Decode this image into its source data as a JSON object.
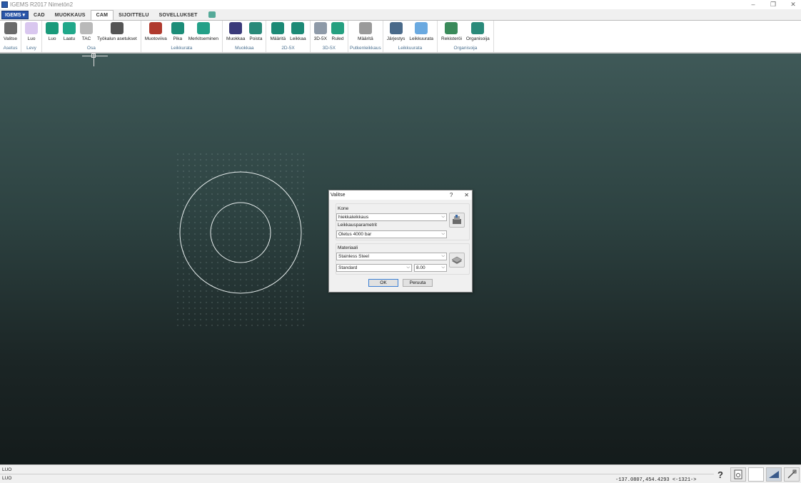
{
  "window": {
    "title": "IGEMS R2017 Nimetön2",
    "controls": [
      "–",
      "❐",
      "✕"
    ]
  },
  "app_menu": {
    "label": "IGEMS ▾"
  },
  "tabs": [
    {
      "label": "CAD",
      "active": false
    },
    {
      "label": "MUOKKAUS",
      "active": false
    },
    {
      "label": "CAM",
      "active": true
    },
    {
      "label": "SIJOITTELU",
      "active": false
    },
    {
      "label": "SOVELLUKSET",
      "active": false
    }
  ],
  "ribbon": {
    "groups": [
      {
        "label": "Asetus",
        "buttons": [
          {
            "label": "Valitse",
            "icon": "machine-icon",
            "color": "#6a6a6a"
          }
        ]
      },
      {
        "label": "Levy",
        "buttons": [
          {
            "label": "Luo",
            "icon": "sheet-icon",
            "color": "#d9c7ef"
          }
        ]
      },
      {
        "label": "Osa",
        "buttons": [
          {
            "label": "Luo",
            "icon": "part-create-icon",
            "color": "#1a9a7a"
          },
          {
            "label": "Laatu",
            "icon": "quality-icon",
            "color": "#21a88a"
          },
          {
            "label": "TAC",
            "icon": "tac-icon",
            "color": "#b9b9b9"
          },
          {
            "label": "Työkalun asetukset",
            "icon": "tool-settings-icon",
            "color": "#555555"
          }
        ]
      },
      {
        "label": "Leikkurata",
        "buttons": [
          {
            "label": "Muotoviiva",
            "icon": "contour-icon",
            "color": "#b03a2e"
          },
          {
            "label": "Pika",
            "icon": "quick-icon",
            "color": "#1c8d78"
          },
          {
            "label": "Merkitseminen",
            "icon": "marking-icon",
            "color": "#23a088"
          }
        ]
      },
      {
        "label": "Muokkaa",
        "buttons": [
          {
            "label": "Muokkaa",
            "icon": "edit-path-icon",
            "color": "#3a3a7a"
          },
          {
            "label": "Poista",
            "icon": "delete-path-icon",
            "color": "#2a8a7a"
          }
        ]
      },
      {
        "label": "2D-5X",
        "buttons": [
          {
            "label": "Määritä",
            "icon": "define-2d5x-icon",
            "color": "#1c8a76"
          },
          {
            "label": "Leikkaa",
            "icon": "cut-2d5x-icon",
            "color": "#1c8a76"
          }
        ]
      },
      {
        "label": "3D-5X",
        "buttons": [
          {
            "label": "3D-5X",
            "icon": "3d5x-icon",
            "color": "#8e9aa8"
          },
          {
            "label": "Ruled",
            "icon": "ruled-icon",
            "color": "#25a080"
          }
        ]
      },
      {
        "label": "Putkenleikkaus",
        "buttons": [
          {
            "label": "Määritä",
            "icon": "tube-icon",
            "color": "#9a9a9a"
          }
        ]
      },
      {
        "label": "Leikkuurata",
        "buttons": [
          {
            "label": "Järjestys",
            "icon": "sequence-icon",
            "color": "#4a6a8a"
          },
          {
            "label": "Leikkuurata",
            "icon": "play-path-icon",
            "color": "#6aa9e0"
          }
        ]
      },
      {
        "label": "Organisoija",
        "buttons": [
          {
            "label": "Rekisteröi",
            "icon": "register-icon",
            "color": "#3a8a5a"
          },
          {
            "label": "Organisoija",
            "icon": "organizer-icon",
            "color": "#2a8a7a"
          }
        ]
      }
    ]
  },
  "dialog": {
    "title": "Valitse",
    "help": "?",
    "close": "✕",
    "machine_label": "Kone",
    "machine_value": "hiekkaleikkaus",
    "params_label": "Leikkausparametrit",
    "params_value": "Oletus 4000 bar",
    "material_label": "Materiaali",
    "material_value": "Stainless Steel",
    "grade_value": "Standard",
    "thickness_value": "8.00",
    "ok_label": "OK",
    "cancel_label": "Peruuta"
  },
  "status": {
    "line1": "LUO",
    "line2": "LUO",
    "coords": "-137.0807,454.4293 <-1321->",
    "help_icon": "?"
  }
}
